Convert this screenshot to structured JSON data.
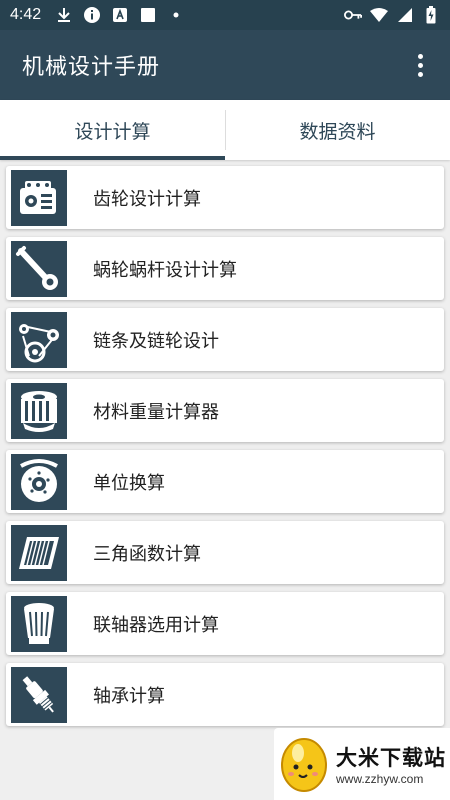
{
  "status_bar": {
    "time": "4:42",
    "left_icons": [
      "download-icon",
      "info-icon",
      "a-badge-icon",
      "square-icon",
      "dot-icon"
    ],
    "right_icons": [
      "vpn-key-icon",
      "wifi-icon",
      "signal-icon",
      "battery-icon"
    ]
  },
  "app_bar": {
    "title": "机械设计手册"
  },
  "tabs": [
    {
      "label": "设计计算",
      "selected": true
    },
    {
      "label": "数据资料",
      "selected": false
    }
  ],
  "items": [
    {
      "label": "齿轮设计计算",
      "icon": "engine-block-icon"
    },
    {
      "label": "蜗轮蜗杆设计计算",
      "icon": "wrench-icon"
    },
    {
      "label": "链条及链轮设计",
      "icon": "chain-belt-icon"
    },
    {
      "label": "材料重量计算器",
      "icon": "oil-filter-icon"
    },
    {
      "label": "单位换算",
      "icon": "brake-disc-icon"
    },
    {
      "label": "三角函数计算",
      "icon": "air-filter-icon"
    },
    {
      "label": "联轴器选用计算",
      "icon": "cone-filter-icon"
    },
    {
      "label": "轴承计算",
      "icon": "spark-plug-icon"
    }
  ],
  "watermark": {
    "title": "大米下载站",
    "url": "www.zzhyw.com"
  },
  "colors": {
    "primary": "#2f4858",
    "status_bar": "#27414f",
    "background": "#efefef"
  }
}
